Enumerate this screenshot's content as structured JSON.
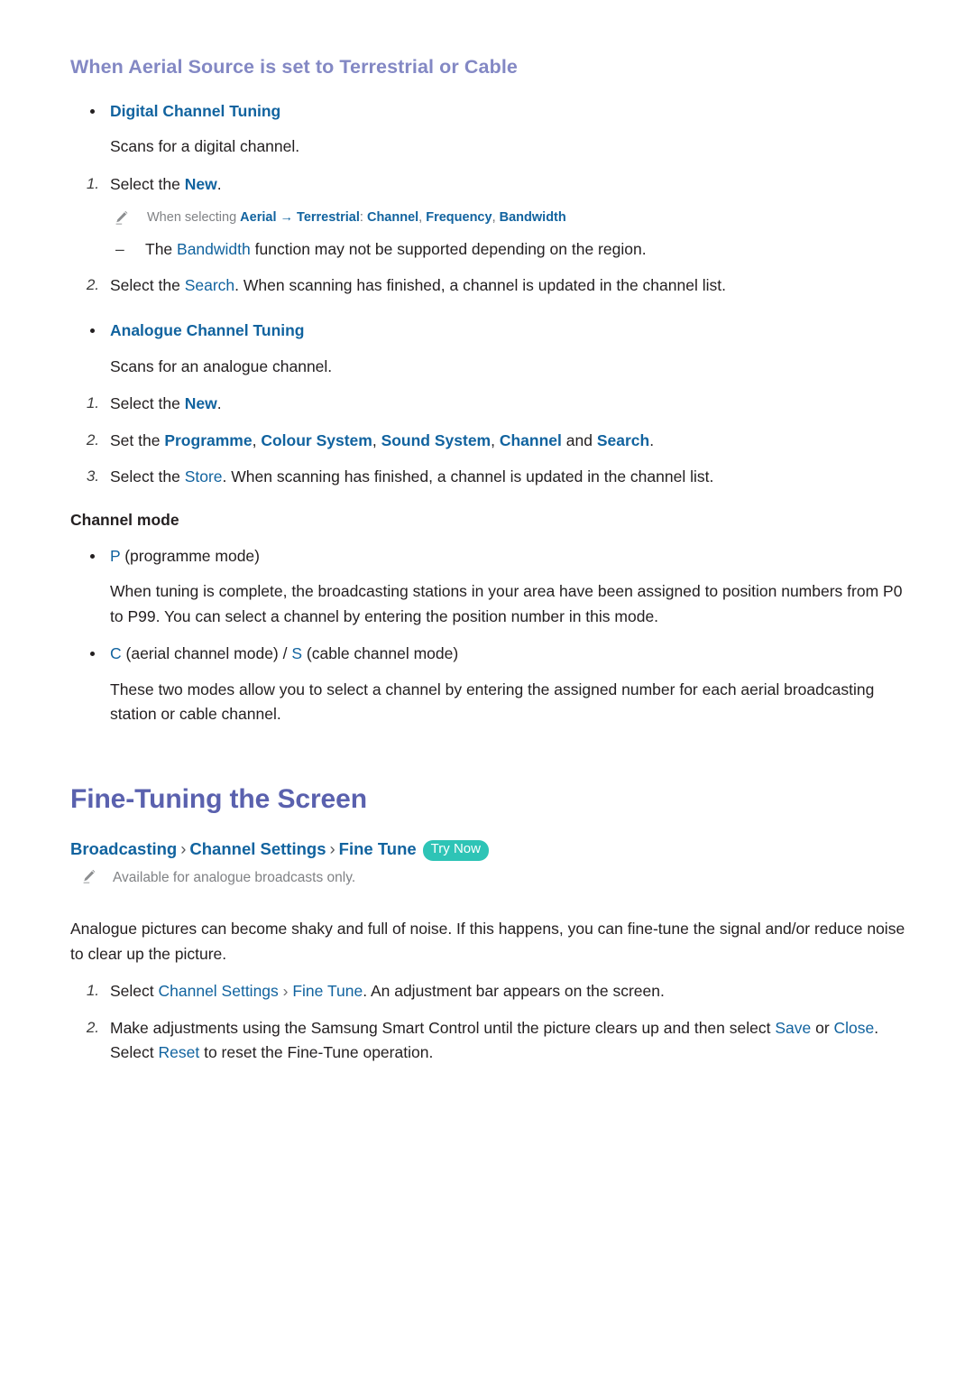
{
  "section_heading": "When Aerial Source is set to Terrestrial or Cable",
  "digital": {
    "bullet_label": "Digital Channel Tuning",
    "desc": "Scans for a digital channel.",
    "step1": {
      "num": "1.",
      "pre": "Select the ",
      "kw": "New",
      "post": "."
    },
    "note": {
      "icon": "pencil-icon",
      "pre": "When selecting ",
      "kw1": "Aerial",
      "arrow": "→",
      "kw2": "Terrestrial",
      "colon": ": ",
      "kw3": "Channel",
      "comma1": ", ",
      "kw4": "Frequency",
      "comma2": ", ",
      "kw5": "Bandwidth"
    },
    "dash": {
      "dash": "–",
      "pre": "The ",
      "kw": "Bandwidth",
      "post": " function may not be supported depending on the region."
    },
    "step2": {
      "num": "2.",
      "pre": "Select the ",
      "kw": "Search",
      "post": ". When scanning has finished, a channel is updated in the channel list."
    }
  },
  "analogue": {
    "bullet_label": "Analogue Channel Tuning",
    "desc": "Scans for an analogue channel.",
    "step1": {
      "num": "1.",
      "pre": "Select the ",
      "kw": "New",
      "post": "."
    },
    "step2": {
      "num": "2.",
      "pre": "Set the ",
      "kw1": "Programme",
      "c1": ", ",
      "kw2": "Colour System",
      "c2": ", ",
      "kw3": "Sound System",
      "c3": ", ",
      "kw4": "Channel",
      "mid": " and ",
      "kw5": "Search",
      "post": "."
    },
    "step3": {
      "num": "3.",
      "pre": "Select the ",
      "kw": "Store",
      "post": ". When scanning has finished, a channel is updated in the channel list."
    }
  },
  "channel_mode": {
    "heading": "Channel mode",
    "item_p": {
      "kw": "P",
      "post": " (programme mode)"
    },
    "para_p": "When tuning is complete, the broadcasting stations in your area have been assigned to position numbers from P0 to P99. You can select a channel by entering the position number in this mode.",
    "item_cs": {
      "kw1": "C",
      "mid1": " (aerial channel mode) / ",
      "kw2": "S",
      "mid2": " (cable channel mode)"
    },
    "para_cs": "These two modes allow you to select a channel by entering the assigned number for each aerial broadcasting station or cable channel."
  },
  "fine_tuning": {
    "heading": "Fine-Tuning the Screen",
    "breadcrumb": {
      "item1": "Broadcasting",
      "sep": "›",
      "item2": "Channel Settings",
      "item3": "Fine Tune",
      "badge": "Try Now"
    },
    "note": {
      "icon": "pencil-icon",
      "text": "Available for analogue broadcasts only."
    },
    "intro": "Analogue pictures can become shaky and full of noise. If this happens, you can fine-tune the signal and/or reduce noise to clear up the picture.",
    "step1": {
      "num": "1.",
      "pre": "Select ",
      "kw1": "Channel Settings",
      "sep": " › ",
      "kw2": "Fine Tune",
      "post": ". An adjustment bar appears on the screen."
    },
    "step2": {
      "num": "2.",
      "pre": "Make adjustments using the Samsung Smart Control until the picture clears up and then select ",
      "kw1": "Save",
      "mid1": " or ",
      "kw2": "Close",
      "mid2": ". Select ",
      "kw3": "Reset",
      "post": " to reset the Fine-Tune operation."
    }
  },
  "colors": {
    "section_heading": "#8388c4",
    "page_heading": "#5a61ae",
    "keyword_blue": "#11639f",
    "note_gray": "#808285",
    "badge_teal": "#2ec4b6",
    "body_text": "#231f20"
  }
}
